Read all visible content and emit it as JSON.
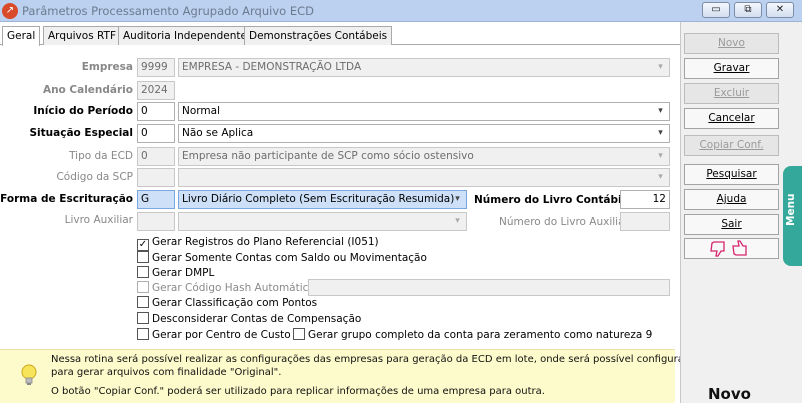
{
  "window": {
    "title": "Parâmetros Processamento Agrupado Arquivo ECD",
    "minimize": "▭",
    "restore": "⧉",
    "close": "✕"
  },
  "tabs": [
    "Geral",
    "Arquivos RTF",
    "Auditoria Independente",
    "Demonstrações Contábeis"
  ],
  "form": {
    "empresa_label": "Empresa",
    "empresa_code": "9999",
    "empresa_name": "EMPRESA - DEMONSTRAÇÃO LTDA",
    "ano_label": "Ano Calendário",
    "ano_value": "2024",
    "inicio_label": "Início do Período",
    "inicio_code": "0",
    "inicio_value": "Normal",
    "situacao_label": "Situação Especial",
    "situacao_code": "0",
    "situacao_value": "Não se Aplica",
    "tipo_label": "Tipo da ECD",
    "tipo_code": "0",
    "tipo_value": "Empresa não participante de SCP como sócio ostensivo",
    "scp_label": "Código da SCP",
    "forma_label": "Forma de Escrituração",
    "forma_code": "G",
    "forma_value": "Livro Diário Completo (Sem Escrituração Resumida)",
    "numero_label": "Número do Livro Contábil",
    "numero_value": "12",
    "livro_aux_label": "Livro Auxiliar",
    "numero_aux_label": "Número do Livro Auxiliar"
  },
  "checkboxes": [
    {
      "label": "Gerar Registros do Plano Referencial (I051)",
      "checked": true,
      "mark": "✓"
    },
    {
      "label": "Gerar Somente Contas com Saldo ou Movimentação",
      "checked": false
    },
    {
      "label": "Gerar DMPL",
      "checked": false
    },
    {
      "label": "Gerar Código Hash Automático",
      "checked": false
    },
    {
      "label": "Gerar Classificação com Pontos",
      "checked": false
    },
    {
      "label": "Desconsiderar Contas de Compensação",
      "checked": false
    },
    {
      "label": "Gerar por Centro de Custo",
      "checked": false
    },
    {
      "label": "Gerar grupo completo da conta para zeramento como natureza 9",
      "checked": false
    }
  ],
  "buttons": {
    "novo": "Novo",
    "gravar": "Gravar",
    "excluir": "Excluir",
    "cancelar": "Cancelar",
    "copiar": "Copiar Conf.",
    "pesquisar": "Pesquisar",
    "ajuda": "Ajuda",
    "sair": "Sair"
  },
  "menu_tab": "Menu",
  "mode_label": "Novo",
  "info": {
    "line1": "Nessa rotina será possível realizar as configurações das empresas para geração da ECD em lote, onde será possível configurar",
    "line2": "para gerar arquivos com finalidade \"Original\".",
    "line3": "O botão \"Copiar Conf.\" poderá ser utilizado para replicar informações de uma empresa para outra."
  },
  "colors": {
    "menu_tab": "#34a89a",
    "info_bg": "#fdfacb",
    "feedback": "#d6246e"
  }
}
